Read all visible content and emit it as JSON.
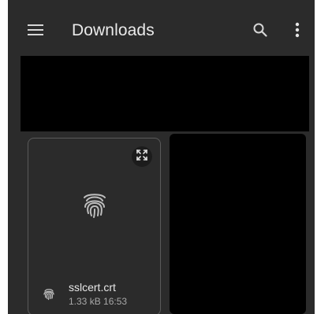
{
  "app_bar": {
    "title": "Downloads",
    "menu_icon": "hamburger-menu-icon",
    "search_icon": "search-icon",
    "more_icon": "more-vert-icon"
  },
  "files": [
    {
      "name": "sslcert.crt",
      "meta": "1.33 kB 16:53",
      "icon": "fingerprint-icon",
      "expand_icon": "expand-icon"
    }
  ],
  "colors": {
    "background": "#2b2b2b",
    "text_primary": "#eaeaea",
    "text_secondary": "#a8a8a8",
    "card_border": "#5a5a5a"
  }
}
